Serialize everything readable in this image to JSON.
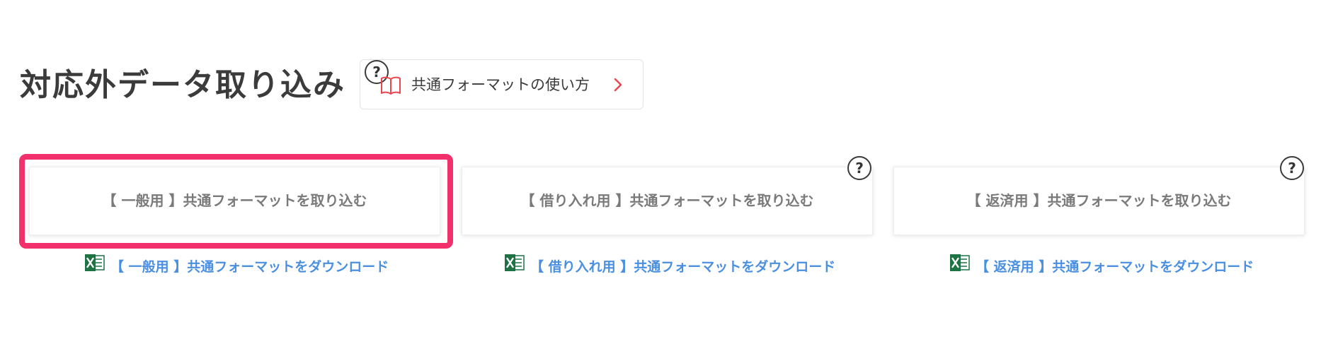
{
  "header": {
    "title": "対応外データ取り込み",
    "guide_label": "共通フォーマットの使い方",
    "help_glyph": "?"
  },
  "import_cards": [
    {
      "label": "【 一般用 】共通フォーマットを取り込む",
      "help_glyph": "",
      "selected": true
    },
    {
      "label": "【 借り入れ用 】共通フォーマットを取り込む",
      "help_glyph": "?",
      "selected": false
    },
    {
      "label": "【 返済用 】共通フォーマットを取り込む",
      "help_glyph": "?",
      "selected": false
    }
  ],
  "download_links": [
    {
      "label": "【 一般用 】共通フォーマットをダウンロード",
      "icon": "excel-icon"
    },
    {
      "label": "【 借り入れ用 】共通フォーマットをダウンロード",
      "icon": "excel-icon"
    },
    {
      "label": "【 返済用 】共通フォーマットをダウンロード",
      "icon": "excel-icon"
    }
  ],
  "colors": {
    "highlight": "#f1306c",
    "link": "#4a8fe0",
    "excel_green": "#1f7244",
    "chevron": "#e8474f",
    "book_icon": "#e8474f"
  },
  "icons": {
    "guide_book": "book-icon",
    "guide_chevron": "chevron-right-icon",
    "help": "help-icon"
  }
}
